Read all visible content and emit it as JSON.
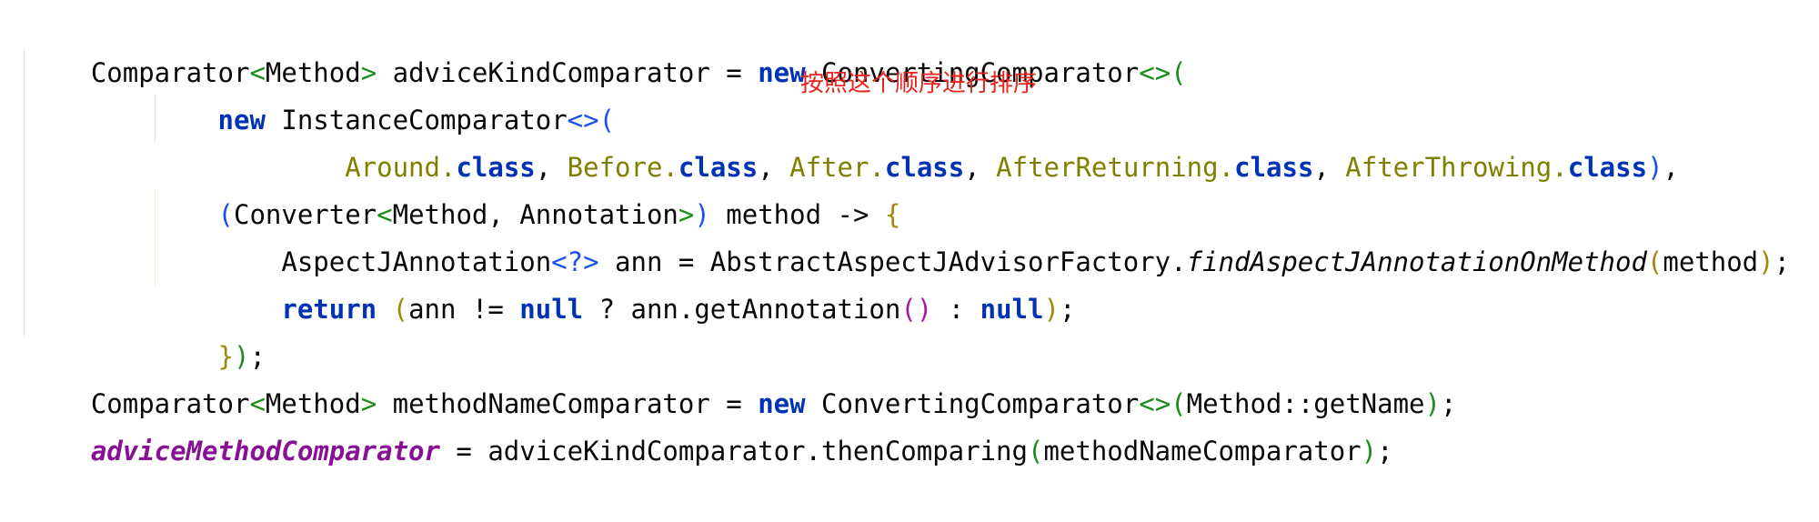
{
  "code": {
    "line1": {
      "t1": "Comparator",
      "t2": "<",
      "t3": "Method",
      "t4": ">",
      "t5": " adviceKindComparator = ",
      "t6": "new",
      "t7": " ConvertingComparator",
      "t8": "<>",
      "t9": "("
    },
    "line2": {
      "indent": "        ",
      "t1": "new",
      "t2": " InstanceComparator",
      "t3": "<>",
      "t4": "("
    },
    "line3": {
      "indent": "                ",
      "t1": "Around",
      "t2": ".",
      "t3": "class",
      "t4": ", ",
      "t5": "Before",
      "t6": ".",
      "t7": "class",
      "t8": ", ",
      "t9": "After",
      "t10": ".",
      "t11": "class",
      "t12": ", ",
      "t13": "AfterReturning",
      "t14": ".",
      "t15": "class",
      "t16": ", ",
      "t17": "AfterThrowing",
      "t18": ".",
      "t19": "class",
      "t20": ")",
      "t21": ","
    },
    "line4": {
      "indent": "        ",
      "t1": "(",
      "t2": "Converter",
      "t3": "<",
      "t4": "Method, Annotation",
      "t5": ">",
      "t6": ")",
      "t7": " method -> ",
      "t8": "{"
    },
    "line5": {
      "indent": "            ",
      "t1": "AspectJAnnotation",
      "t2": "<?>",
      "t3": " ann = AbstractAspectJAdvisorFactory.",
      "t4": "findAspectJAnnotationOnMethod",
      "t5": "(",
      "t6": "method",
      "t7": ")",
      "t8": ";"
    },
    "line6": {
      "indent": "            ",
      "t1": "return",
      "t2": " ",
      "t3": "(",
      "t4": "ann != ",
      "t5": "null",
      "t6": " ? ann.getAnnotation",
      "t7": "()",
      "t8": " : ",
      "t9": "null",
      "t10": ")",
      "t11": ";"
    },
    "line7": {
      "indent": "        ",
      "t1": "}",
      "t2": ")",
      "t3": ";"
    },
    "line8": {
      "t1": "Comparator",
      "t2": "<",
      "t3": "Method",
      "t4": ">",
      "t5": " methodNameComparator = ",
      "t6": "new",
      "t7": " ConvertingComparator",
      "t8": "<>",
      "t9": "(",
      "t10": "Method::getName",
      "t11": ")",
      "t12": ";"
    },
    "line9": {
      "t1": "adviceMethodComparator",
      "t2": " = adviceKindComparator.thenComparing",
      "t3": "(",
      "t4": "methodNameComparator",
      "t5": ")",
      "t6": ";"
    }
  },
  "annotation": {
    "text": "按照这个顺序进行排序",
    "color": "#e8231c"
  },
  "colors": {
    "background": "#ffffff",
    "keyword": "#0033b3",
    "annotation_class": "#808000",
    "field": "#871094",
    "paren_level1": "#9e880d",
    "paren_level2": "#1a8d1a",
    "paren_level3": "#1750eb",
    "paren_level4": "#a31aa3"
  }
}
